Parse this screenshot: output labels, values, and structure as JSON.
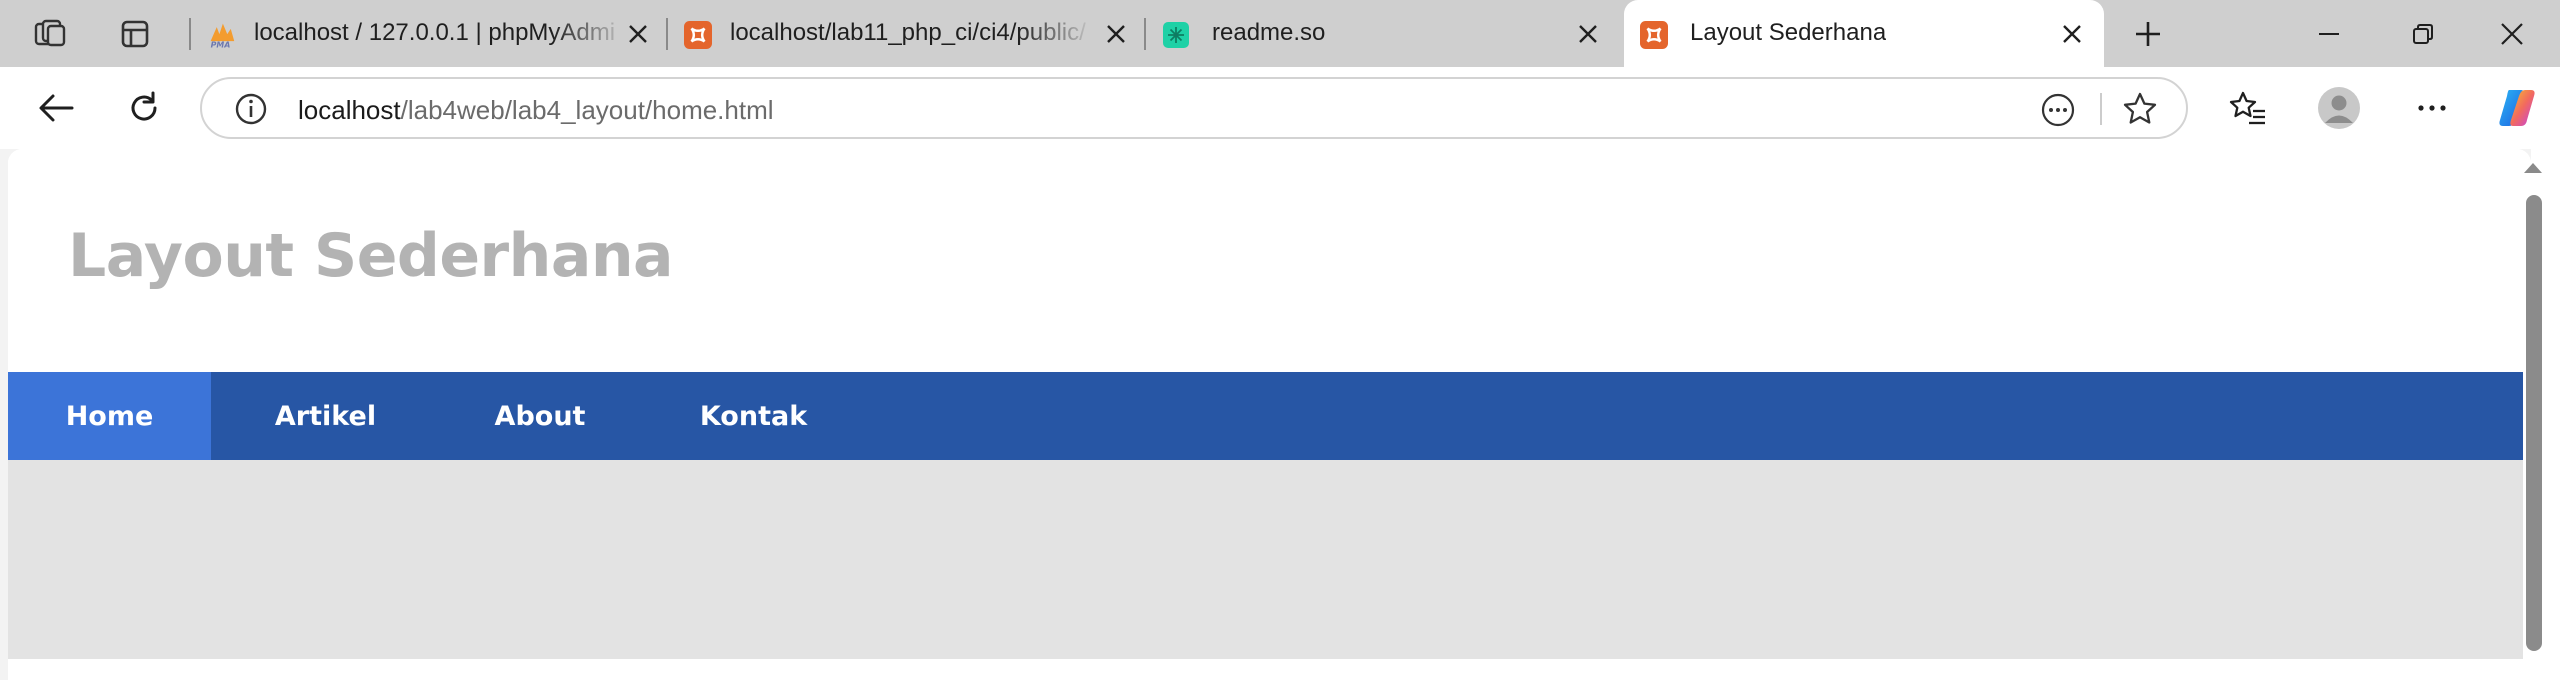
{
  "browser": {
    "tabs": [
      {
        "title": "localhost / 127.0.0.1 | phpMyAdmin",
        "favicon": "phpmyadmin-icon",
        "active": false
      },
      {
        "title": "localhost/lab11_php_ci/ci4/public/",
        "favicon": "xampp-icon",
        "active": false
      },
      {
        "title": "readme.so",
        "favicon": "readme-icon",
        "active": false
      },
      {
        "title": "Layout Sederhana",
        "favicon": "xampp-icon",
        "active": true
      }
    ],
    "address": {
      "host": "localhost",
      "path": "/lab4web/lab4_layout/home.html"
    },
    "colors": {
      "tabstrip": "#cfcfcf",
      "xampp": "#e4652c",
      "readme": "#1fd1a6"
    }
  },
  "page": {
    "title": "Layout Sederhana",
    "nav": [
      {
        "label": "Home",
        "active": true
      },
      {
        "label": "Artikel",
        "active": false
      },
      {
        "label": "About",
        "active": false
      },
      {
        "label": "Kontak",
        "active": false
      }
    ],
    "colors": {
      "title": "#b3b3b3",
      "nav_bg": "#2756a5",
      "nav_active": "#3c74d8",
      "content_bg": "#e3e3e3"
    }
  }
}
